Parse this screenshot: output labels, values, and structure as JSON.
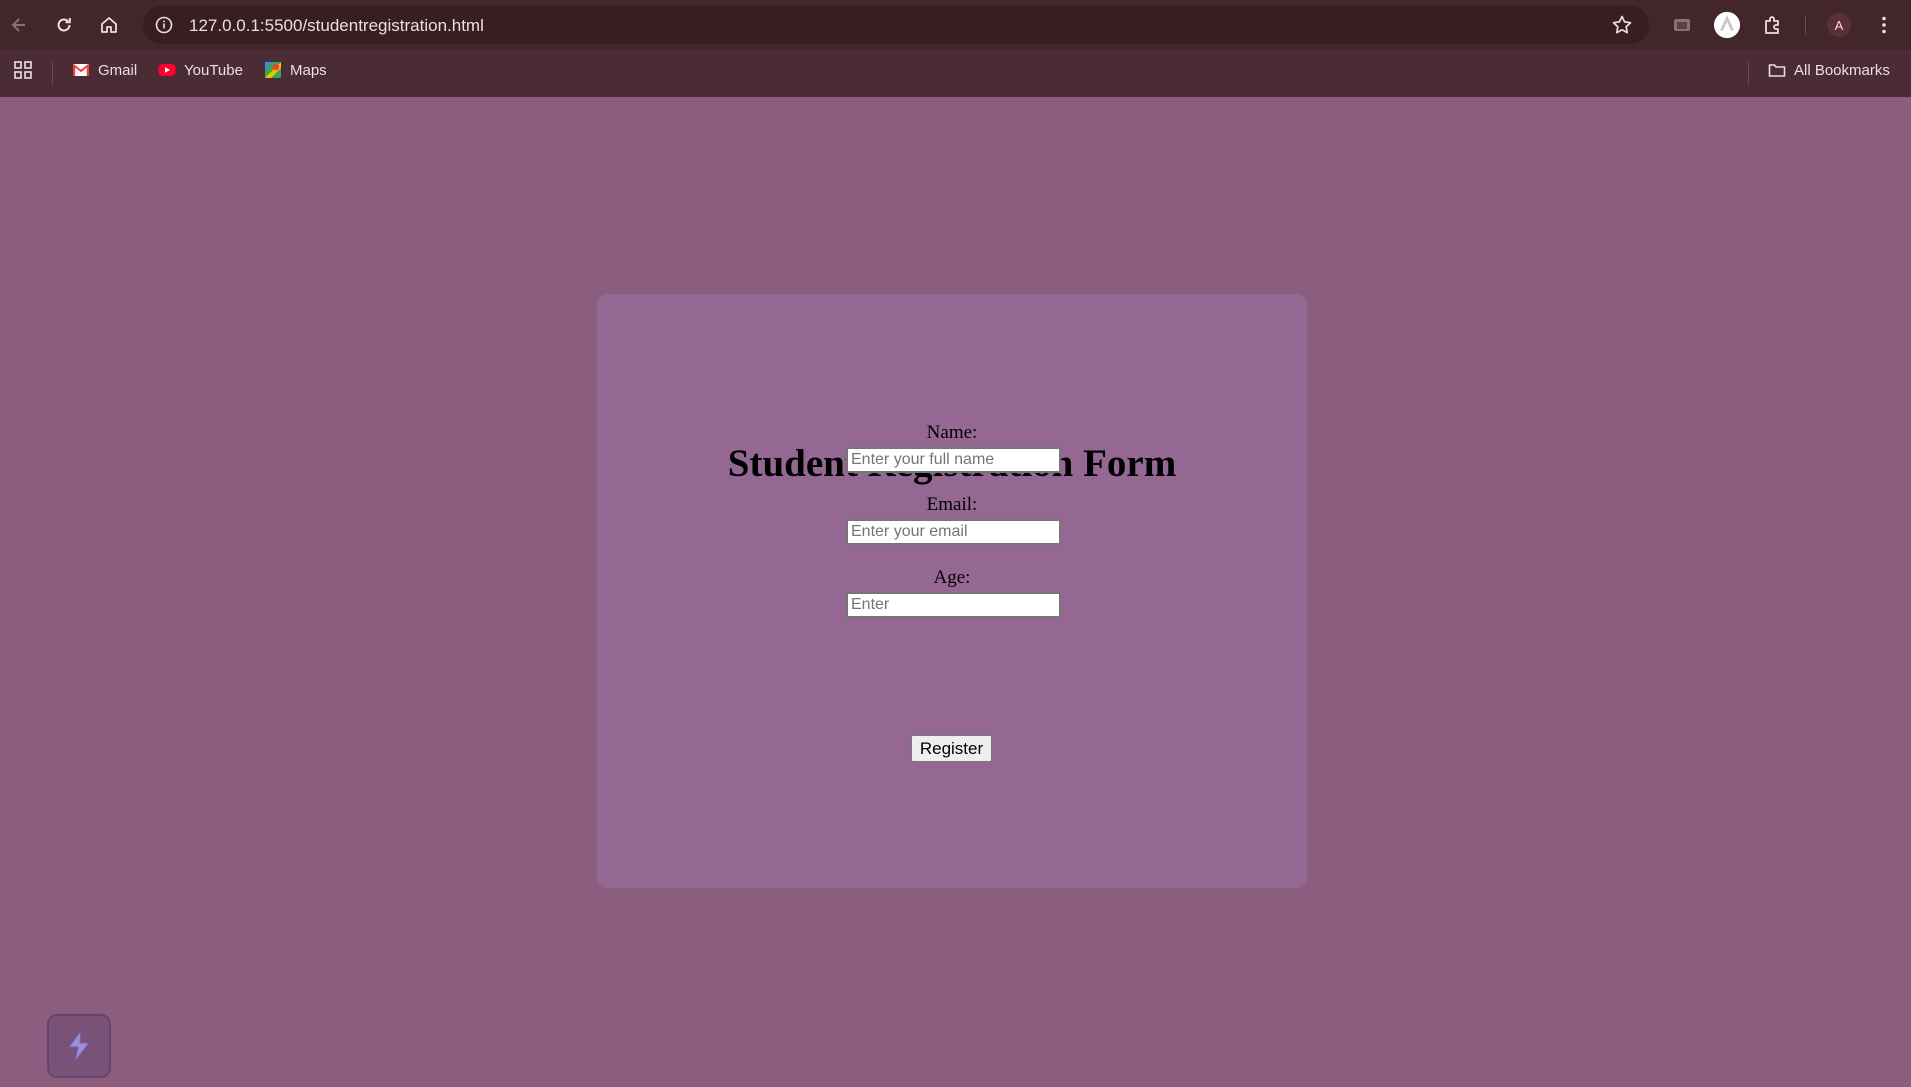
{
  "browser": {
    "url": "127.0.0.1:5500/studentregistration.html",
    "profile_initial": "A",
    "bookmarks": [
      {
        "label": "Gmail",
        "icon": "gmail-icon"
      },
      {
        "label": "YouTube",
        "icon": "youtube-icon"
      },
      {
        "label": "Maps",
        "icon": "maps-icon"
      }
    ],
    "all_bookmarks_label": "All Bookmarks"
  },
  "form": {
    "title": "Student Registration Form",
    "fields": [
      {
        "label": "Name:",
        "placeholder": "Enter your full name",
        "value": ""
      },
      {
        "label": "Email:",
        "placeholder": "Enter your email",
        "value": ""
      },
      {
        "label": "Age:",
        "placeholder": "Enter",
        "value": ""
      }
    ],
    "submit_label": "Register"
  },
  "colors": {
    "page_background": "#8b5d7e",
    "card_background": "#946893",
    "toolbar_background": "#43252c",
    "omnibox_background": "#381d22"
  }
}
